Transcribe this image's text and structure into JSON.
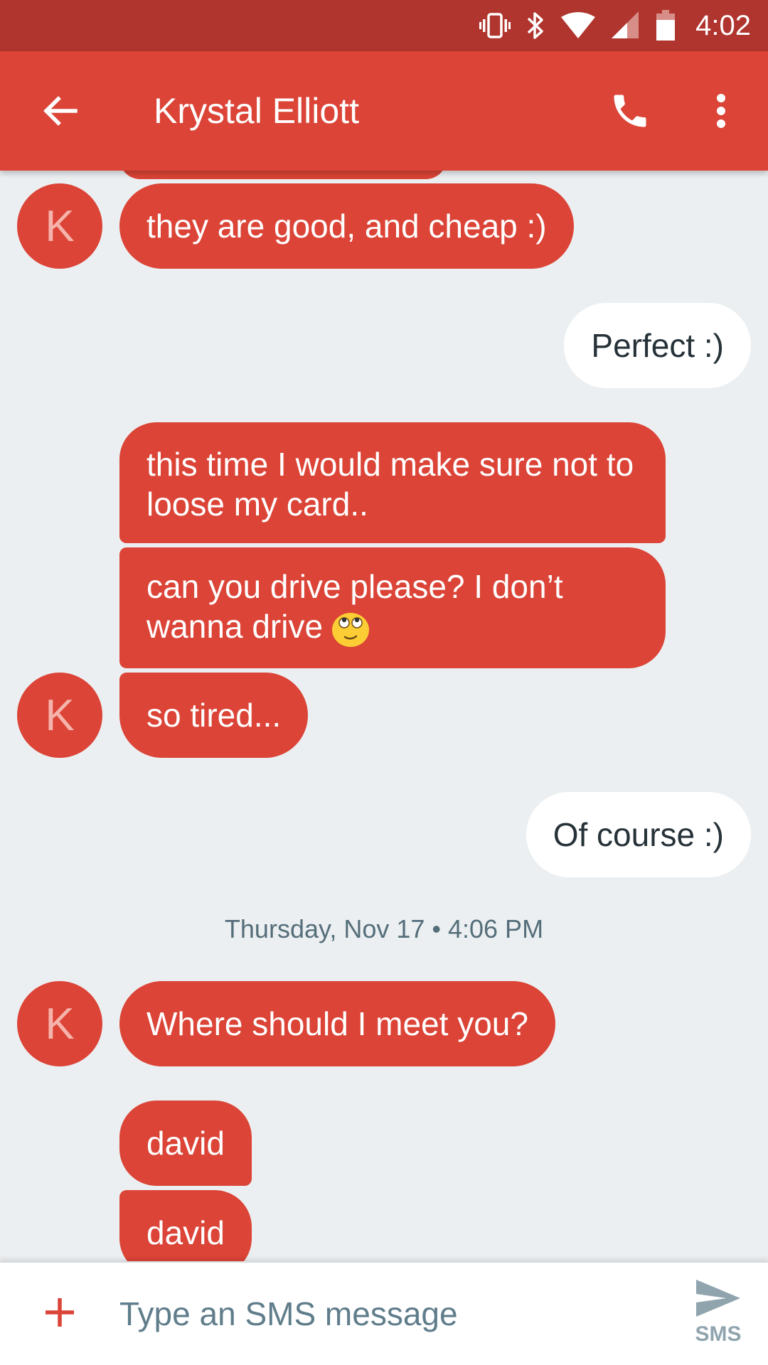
{
  "status_bar": {
    "time": "4:02",
    "icons": [
      "vibrate-icon",
      "bluetooth-icon",
      "wifi-icon",
      "signal-icon",
      "battery-icon"
    ]
  },
  "app_bar": {
    "title": "Krystal Elliott",
    "back_icon": "arrow-back-icon",
    "call_icon": "phone-icon",
    "more_icon": "more-vert-icon",
    "color": "#db4437"
  },
  "avatar_letter": "K",
  "messages": [
    {
      "direction": "in",
      "text": "they are good, and cheap :)"
    },
    {
      "direction": "out",
      "text": "Perfect :)"
    },
    {
      "direction": "in",
      "text": "this time I would make sure not to loose my card.."
    },
    {
      "direction": "in",
      "text": "can you drive please? I don’t wanna drive",
      "emoji": "rolling-eyes-emoji"
    },
    {
      "direction": "in",
      "text": "so tired..."
    },
    {
      "direction": "out",
      "text": "Of course :)"
    },
    {
      "direction": "in",
      "text": "Where should I meet you?"
    },
    {
      "direction": "in",
      "text": "david"
    },
    {
      "direction": "in",
      "text": "david"
    }
  ],
  "timestamp": "Thursday, Nov 17 • 4:06 PM",
  "compose": {
    "placeholder": "Type an SMS message",
    "value": "",
    "attach_icon": "plus-icon",
    "send_icon": "send-icon",
    "send_label": "SMS"
  },
  "colors": {
    "incoming_bubble": "#db4437",
    "outgoing_bubble": "#ffffff",
    "status_bar": "#b0352e",
    "background": "#eceff1"
  }
}
